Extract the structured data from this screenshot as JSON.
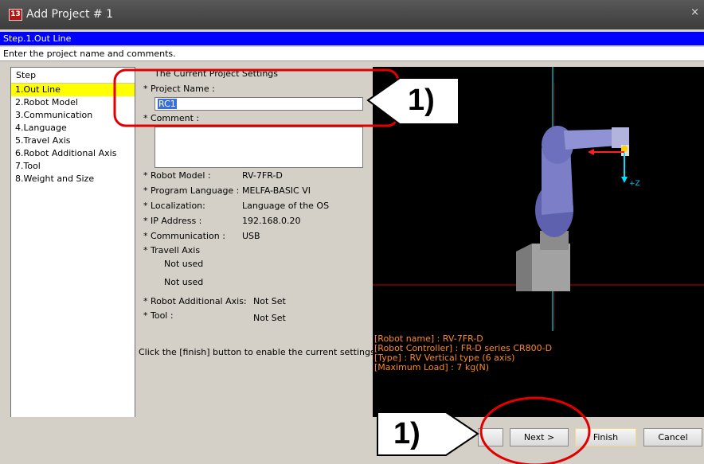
{
  "window": {
    "title": "Add Project # 1",
    "close_glyph": "×"
  },
  "step_header": "Step.1.Out Line",
  "description": "Enter the project name and comments.",
  "steps": {
    "header": "Step",
    "items": [
      "1.Out Line",
      "2.Robot Model",
      "3.Communication",
      "4.Language",
      "5.Travel Axis",
      "6.Robot Additional Axis",
      "7.Tool",
      "8.Weight and Size"
    ],
    "active_index": 0
  },
  "settings": {
    "section_title": "The Current Project Settings",
    "project_name_label": "* Project Name :",
    "project_name_value": "RC1",
    "comment_label": "* Comment :",
    "comment_value": "",
    "rows": [
      {
        "label": "* Robot Model :",
        "value": "RV-7FR-D"
      },
      {
        "label": "* Program Language :",
        "value": "MELFA-BASIC VI"
      },
      {
        "label": "* Localization:",
        "value": "Language of the OS"
      },
      {
        "label": "* IP Address :",
        "value": "192.168.0.20"
      },
      {
        "label": "* Communication :",
        "value": "USB"
      }
    ],
    "travel_label": "* Travell Axis",
    "travel_values": [
      "Not used",
      "Not used"
    ],
    "additional_axis_label": "* Robot Additional Axis:",
    "additional_axis_value": "Not Set",
    "tool_label": "* Tool :",
    "tool_value": "Not Set",
    "hint": "Click the [finish] button to enable the current settings."
  },
  "preview": {
    "info_lines": [
      "[Robot name] : RV-7FR-D",
      "[Robot Controller] : FR-D series CR800-D",
      "[Type] : RV Vertical type (6 axis)",
      "[Maximum Load] : 7 kg(N)"
    ],
    "axis_marker": "+Z",
    "colors": {
      "background": "#000000",
      "grid_red": "#c00000",
      "axis_cyan": "#00ffff",
      "arm": "#7c7fc8",
      "base": "#9a9a9a"
    }
  },
  "buttons": {
    "back": "",
    "next": "Next >",
    "finish": "Finish",
    "cancel": "Cancel"
  },
  "annotations": {
    "callout_top": "1)",
    "callout_bottom": "1)",
    "highlight_color": "#e00000"
  },
  "colors": {
    "accent": "#0000ff",
    "active_step": "#ffff00",
    "chrome": "#d4d0c8"
  }
}
